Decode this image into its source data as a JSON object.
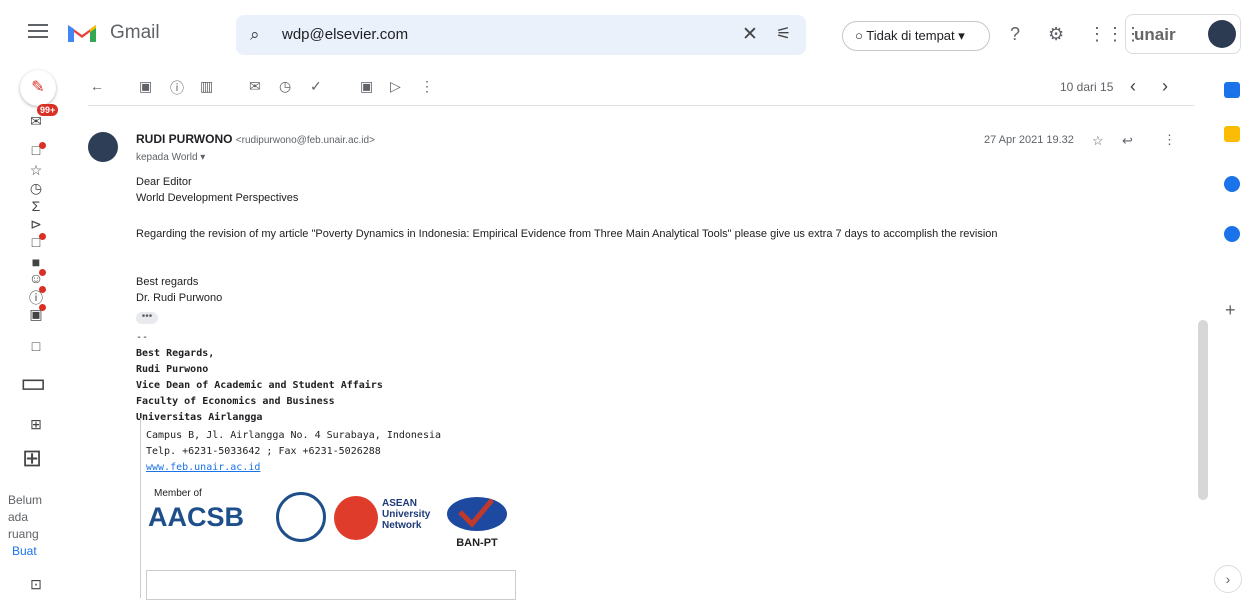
{
  "app": {
    "brand": "Gmail",
    "org": "unair"
  },
  "search": {
    "value": "wdp@elsevier.com"
  },
  "status": {
    "label": "Tidak di tempat ▾"
  },
  "pager": {
    "label": "10 dari 15"
  },
  "badge": "99+",
  "meet": {
    "line1": "Belum",
    "line2": "ada",
    "line3": "ruang",
    "create": "Buat"
  },
  "email": {
    "from_name": "RUDI PURWONO",
    "from_email": "<rudipurwono@feb.unair.ac.id>",
    "to": "kepada World ▾",
    "date": "27 Apr 2021 19.32",
    "greeting_1": "Dear Editor",
    "greeting_2": "World Development Perspectives",
    "body": "Regarding the revision of my article \"Poverty Dynamics in Indonesia: Empirical Evidence from Three Main Analytical Tools\" please give us extra 7 days to accomplish the revision",
    "closing_1": "Best regards",
    "closing_2": "Dr. Rudi Purwono",
    "dots": "•••",
    "sep": "--",
    "sig_1": "Best Regards,",
    "sig_2": "Rudi Purwono",
    "sig_3": "Vice Dean of Academic and Student Affairs",
    "sig_4": "Faculty of Economics and Business",
    "sig_5": "Universitas Airlangga",
    "addr_1": "Campus B, Jl. Airlangga No. 4 Surabaya, Indonesia",
    "addr_2": "Telp. +6231-5033642 ; Fax +6231-5026288",
    "web": "www.feb.unair.ac.id",
    "member_of": "Member of",
    "aacsb": "AACSB",
    "asean_1": "ASEAN",
    "asean_2": "University",
    "asean_3": "Network",
    "banpt": "BAN-PT"
  }
}
